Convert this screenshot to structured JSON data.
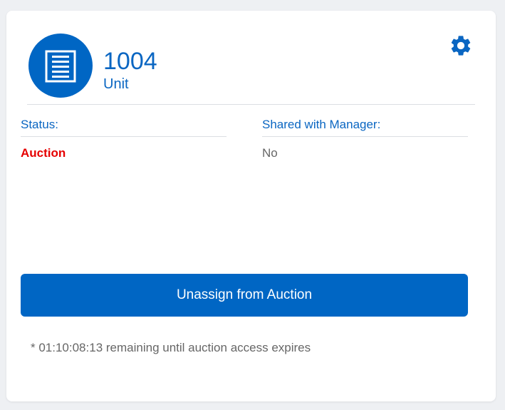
{
  "colors": {
    "accent": "#0066c4",
    "status_red": "#e60000",
    "muted_text": "#666666"
  },
  "unit": {
    "number": "1004",
    "type_label": "Unit",
    "icon": "storage-unit-door-icon"
  },
  "settings": {
    "icon": "gear-icon"
  },
  "fields": {
    "status": {
      "label": "Status:",
      "value": "Auction"
    },
    "shared_with_manager": {
      "label": "Shared with Manager:",
      "value": "No"
    }
  },
  "actions": {
    "unassign_label": "Unassign from Auction"
  },
  "note": "* 01:10:08:13 remaining until auction access expires"
}
